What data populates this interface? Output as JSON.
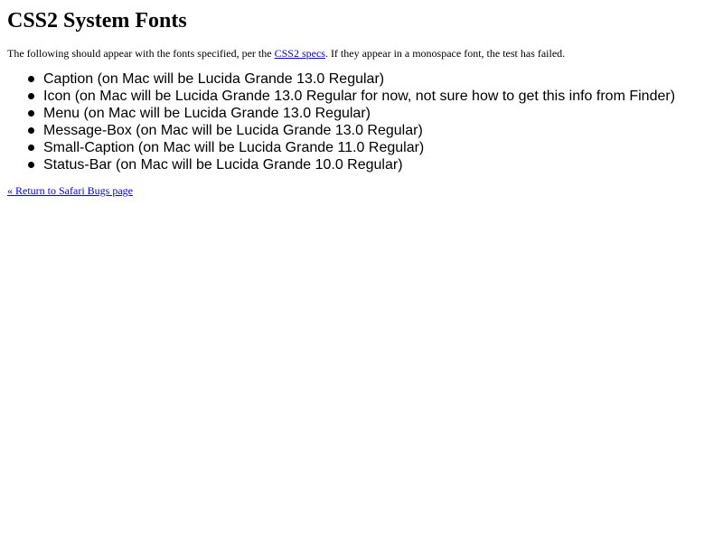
{
  "page": {
    "title": "CSS2 System Fonts",
    "intro_before": "The following should appear with the fonts specified, per the ",
    "intro_link": "CSS2 specs",
    "intro_after": ". If they appear in a monospace font, the test has failed.",
    "font_items": [
      "Caption (on Mac will be Lucida Grande 13.0 Regular)",
      "Icon (on Mac will be Lucida Grande 13.0 Regular for now, not sure how to get this info from Finder)",
      "Menu (on Mac will be Lucida Grande 13.0 Regular)",
      "Message-Box (on Mac will be Lucida Grande 13.0 Regular)",
      "Small-Caption (on Mac will be Lucida Grande 11.0 Regular)",
      "Status-Bar (on Mac will be Lucida Grande 10.0 Regular)"
    ],
    "back_link": "« Return to Safari Bugs page"
  },
  "colors": {
    "link": "#0000ee",
    "text": "#000000",
    "background": "#ffffff"
  },
  "icons": {
    "list_bullet": "bullet-icon"
  }
}
